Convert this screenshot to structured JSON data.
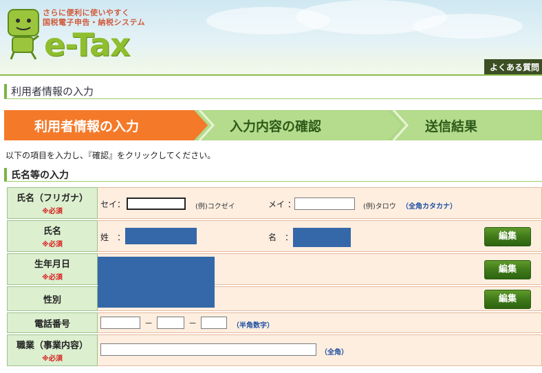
{
  "header": {
    "tagline_line1": "さらに便利に使いやすく",
    "tagline_line2": "国税電子申告・納税システム",
    "logo_text": "e-Tax",
    "faq_label": "よくある質問"
  },
  "page_title": "利用者情報の入力",
  "steps": [
    {
      "label": "利用者情報の入力",
      "active": true
    },
    {
      "label": "入力内容の確認",
      "active": false
    },
    {
      "label": "送信結果",
      "active": false
    }
  ],
  "instruction": "以下の項目を入力し、『確認』をクリックしてください。",
  "section_title": "氏名等の入力",
  "required_mark": "※必須",
  "form": {
    "furigana": {
      "label": "氏名（フリガナ）",
      "sei_label": "セイ：",
      "sei_value": "",
      "sei_example": "(例)コクゼイ",
      "mei_label": "メイ ：",
      "mei_value": "",
      "mei_example": "(例)タロウ",
      "note": "（全角カタカナ）"
    },
    "name": {
      "label": "氏名",
      "sei_label": "姓　：",
      "mei_label": "名　：",
      "edit_label": "編集"
    },
    "dob": {
      "label": "生年月日",
      "edit_label": "編集"
    },
    "gender": {
      "label": "性別",
      "edit_label": "編集"
    },
    "tel": {
      "label": "電話番号",
      "sep": "－",
      "part1": "",
      "part2": "",
      "part3": "",
      "note": "（半角数字）"
    },
    "job": {
      "label": "職業（事業内容）",
      "value": "",
      "note": "（全角）"
    }
  },
  "colors": {
    "accent_orange": "#f47a2a",
    "step_green": "#b4dc8c",
    "redaction": "#3568a8",
    "button_green": "#3f7a1a"
  }
}
